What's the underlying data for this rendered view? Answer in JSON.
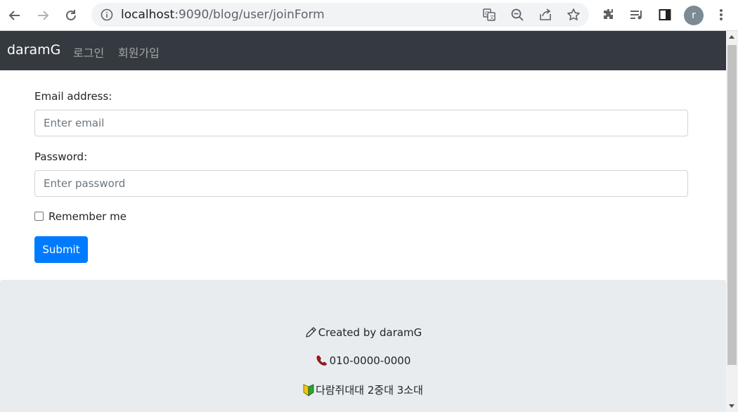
{
  "browser": {
    "url_host": "localhost",
    "url_path": ":9090/blog/user/joinForm",
    "profile_initial": "r"
  },
  "navbar": {
    "brand": "daramG",
    "links": [
      "로그인",
      "회원가입"
    ]
  },
  "form": {
    "email_label": "Email address:",
    "email_placeholder": "Enter email",
    "password_label": "Password:",
    "password_placeholder": "Enter password",
    "remember_label": "Remember me",
    "submit_label": "Submit"
  },
  "footer": {
    "created_by": "Created by daramG",
    "phone": "010-0000-0000",
    "address": "다람쥐대대 2중대 3소대"
  },
  "colors": {
    "navbar_bg": "#343a40",
    "primary": "#007bff",
    "footer_bg": "#e9ecef"
  }
}
